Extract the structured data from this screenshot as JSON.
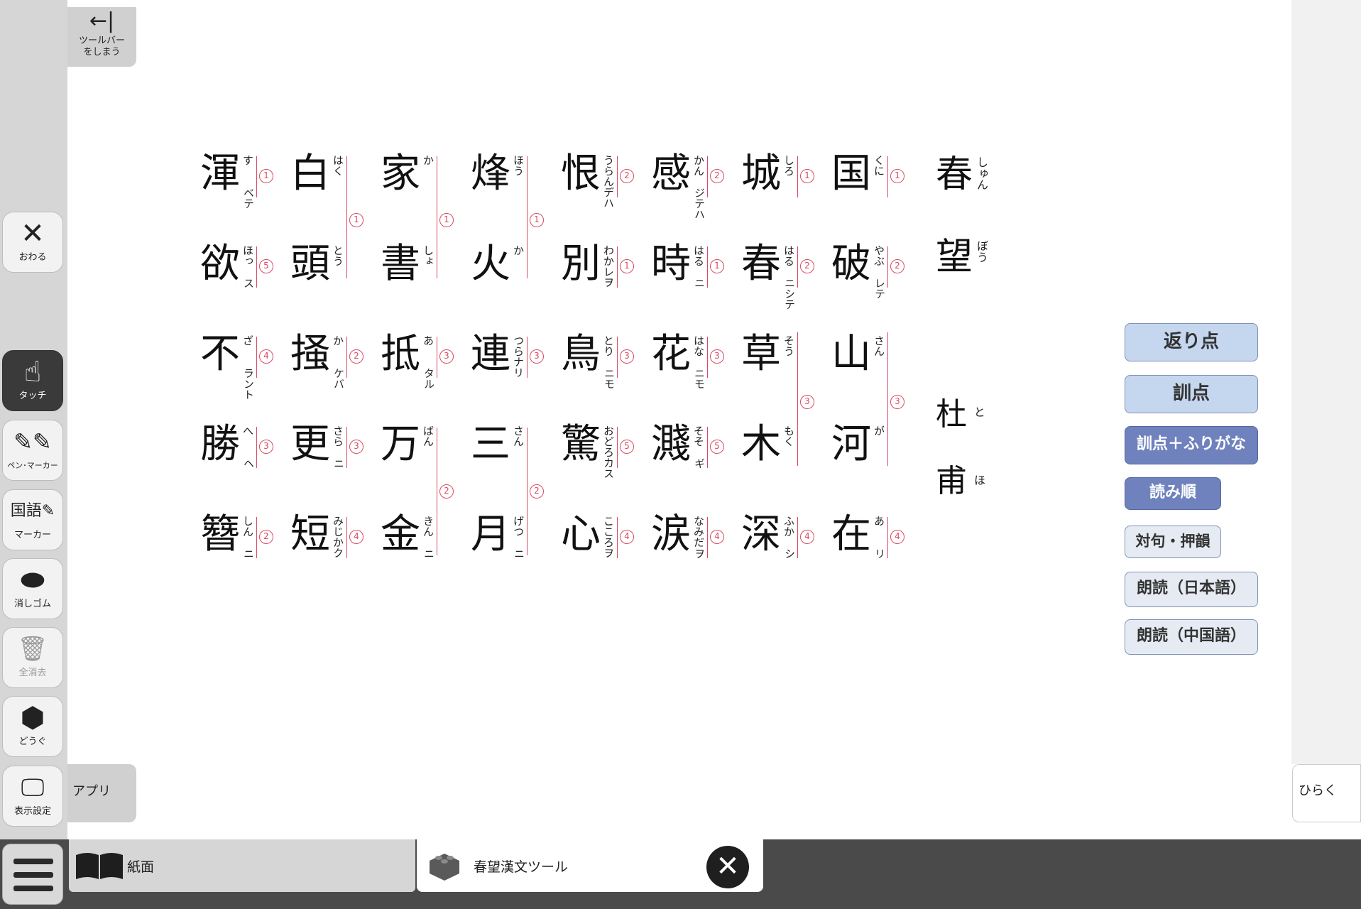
{
  "toolbar": {
    "hide": {
      "arrow": "←|",
      "label1": "ツールバー",
      "label2": "をしまう"
    },
    "items": [
      {
        "name": "close",
        "icon": "✕",
        "label": "おわる"
      },
      {
        "name": "touch",
        "icon": "☝",
        "label": "タッチ"
      },
      {
        "name": "pen",
        "icon": "✎✎",
        "label": "ペン･マーカー"
      },
      {
        "name": "kokugo",
        "icon": "国語✎",
        "label": "マーカー"
      },
      {
        "name": "eraser",
        "icon": "⬬",
        "label": "消しゴム"
      },
      {
        "name": "clear",
        "icon": "🗑",
        "label": "全消去"
      },
      {
        "name": "tools",
        "icon": "⬢",
        "label": "どうぐ"
      },
      {
        "name": "display",
        "icon": "🖵",
        "label": "表示設定"
      }
    ],
    "app_label": "アプリ"
  },
  "tabs": {
    "paper": "紙面",
    "tool": "春望漢文ツール",
    "close": "✕"
  },
  "open_label": "ひらく",
  "buttons": {
    "kaeriten": "返り点",
    "kunten": "訓点",
    "kunten_furi": "訓点＋ふりがな",
    "yomijun": "読み順",
    "tsuiku": "対句・押韻",
    "roudoku_ja": "朗読（日本語）",
    "roudoku_zh": "朗読（中国語）"
  },
  "title": {
    "c1": "春",
    "f1": "しゅん",
    "c2": "望",
    "f2": "ぼう"
  },
  "author": {
    "c1": "杜",
    "f1": "と",
    "c2": "甫",
    "f2": "ほ"
  },
  "colors": {
    "accent_line": "#d84a63",
    "button_light": "#c5d6ef",
    "button_dark": "#6f82bd",
    "toolbar": "#d6d6d6"
  },
  "poem": [
    {
      "cells": [
        {
          "k": "国",
          "f": "くに",
          "o": "",
          "n": "1"
        },
        {
          "k": "破",
          "f": "やぶ",
          "o": "レテ",
          "n": "2"
        },
        {
          "k": "山",
          "f": "さん",
          "o": "",
          "n": ""
        },
        {
          "k": "河",
          "f": "が",
          "o": "",
          "n": ""
        },
        {
          "k": "在",
          "f": "あ",
          "o": "リ",
          "n": "4"
        }
      ],
      "group": "3"
    },
    {
      "cells": [
        {
          "k": "城",
          "f": "しろ",
          "o": "",
          "n": "1"
        },
        {
          "k": "春",
          "f": "はる",
          "o": "ニシテ",
          "n": "2"
        },
        {
          "k": "草",
          "f": "そう",
          "o": "",
          "n": ""
        },
        {
          "k": "木",
          "f": "もく",
          "o": "",
          "n": ""
        },
        {
          "k": "深",
          "f": "ふか",
          "o": "シ",
          "n": "4"
        }
      ],
      "group": "3"
    },
    {
      "cells": [
        {
          "k": "感",
          "f": "かん",
          "o": "ジテハ",
          "n": "2"
        },
        {
          "k": "時",
          "f": "はる",
          "o": "ニ",
          "n": "1"
        },
        {
          "k": "花",
          "f": "はな",
          "o": "ニモ",
          "n": "3"
        },
        {
          "k": "濺",
          "f": "そそ",
          "o": "ギ",
          "n": "5"
        },
        {
          "k": "涙",
          "f": "なみだ",
          "o": "ヲ",
          "n": "4"
        }
      ]
    },
    {
      "cells": [
        {
          "k": "恨",
          "f": "うらんデハ",
          "o": "",
          "n": "2"
        },
        {
          "k": "別",
          "f": "わかレヲ",
          "o": "",
          "n": "1"
        },
        {
          "k": "鳥",
          "f": "とり",
          "o": "ニモ",
          "n": "3"
        },
        {
          "k": "驚",
          "f": "おどろカス",
          "o": "",
          "n": "5"
        },
        {
          "k": "心",
          "f": "こころヲ",
          "o": "",
          "n": "4"
        }
      ]
    },
    {
      "cells": [
        {
          "k": "烽",
          "f": "ほう",
          "o": "",
          "n": ""
        },
        {
          "k": "火",
          "f": "か",
          "o": "",
          "n": ""
        },
        {
          "k": "連",
          "f": "つらナリ",
          "o": "",
          "n": "3"
        },
        {
          "k": "三",
          "f": "さん",
          "o": "",
          "n": ""
        },
        {
          "k": "月",
          "f": "げつ",
          "o": "ニ",
          "n": ""
        }
      ],
      "group": "1",
      "group2": "2"
    },
    {
      "cells": [
        {
          "k": "家",
          "f": "か",
          "o": "",
          "n": ""
        },
        {
          "k": "書",
          "f": "しょ",
          "o": "",
          "n": ""
        },
        {
          "k": "抵",
          "f": "あ",
          "o": "タル",
          "n": "3"
        },
        {
          "k": "万",
          "f": "ばん",
          "o": "",
          "n": ""
        },
        {
          "k": "金",
          "f": "きん",
          "o": "ニ",
          "n": ""
        }
      ],
      "group": "1",
      "group2": "2"
    },
    {
      "cells": [
        {
          "k": "白",
          "f": "はく",
          "o": "",
          "n": ""
        },
        {
          "k": "頭",
          "f": "とう",
          "o": "",
          "n": ""
        },
        {
          "k": "掻",
          "f": "か",
          "o": "ケバ",
          "n": "2"
        },
        {
          "k": "更",
          "f": "さら",
          "o": "ニ",
          "n": "3"
        },
        {
          "k": "短",
          "f": "みじかク",
          "o": "",
          "n": "4"
        }
      ],
      "group": "1"
    },
    {
      "cells": [
        {
          "k": "渾",
          "f": "す",
          "o": "ベテ",
          "n": "1"
        },
        {
          "k": "欲",
          "f": "ほっ",
          "o": "ス",
          "n": "5"
        },
        {
          "k": "不",
          "f": "ざ",
          "o": "ラント",
          "n": "4"
        },
        {
          "k": "勝",
          "f": "へ",
          "o": "ヘ",
          "n": "3"
        },
        {
          "k": "簪",
          "f": "しん",
          "o": "ニ",
          "n": "2"
        }
      ]
    }
  ]
}
